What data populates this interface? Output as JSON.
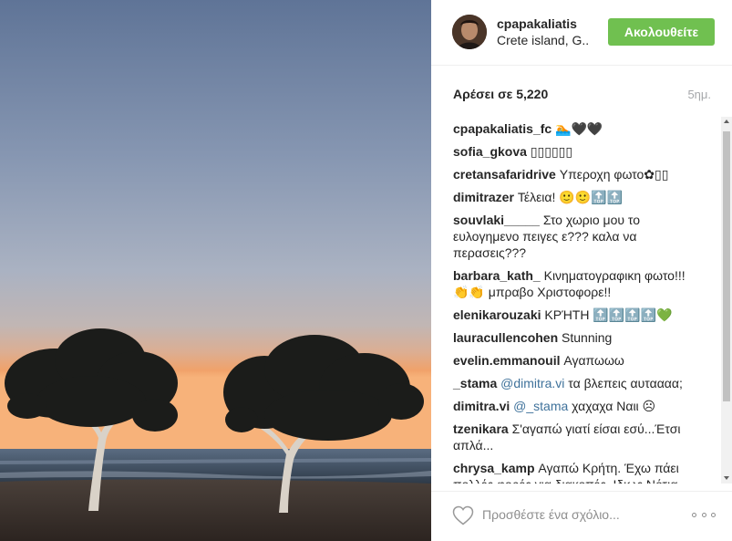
{
  "post": {
    "username": "cpapakaliatis",
    "location": "Crete island, G..",
    "follow_label": "Ακολουθείτε",
    "likes": "Αρέσει σε 5,220",
    "time": "5ημ."
  },
  "comments": [
    {
      "user": "cpapakaliatis_fc",
      "text": "🏊🖤🖤"
    },
    {
      "user": "sofia_gkova",
      "text": "▯▯▯▯▯▯"
    },
    {
      "user": "cretansafaridrive",
      "text": "Υπεροχη φωτο✿▯▯"
    },
    {
      "user": "dimitrazer",
      "text": "Τέλεια! 🙂🙂🔝🔝"
    },
    {
      "user": "souvlaki_____",
      "text": "Στο χωριο μου το ευλογημενο πειγες ε??? καλα να περασεις???"
    },
    {
      "user": "barbara_kath_",
      "text": "Κινηματογραφικη φωτο!!! 👏👏 μπραβο Χριστοφορε!!"
    },
    {
      "user": "elenikarouzaki",
      "text": "ΚΡΉΤΗ 🔝🔝🔝🔝💚"
    },
    {
      "user": "lauracullencohen",
      "text": "Stunning"
    },
    {
      "user": "evelin.emmanouil",
      "text": "Αγαπωωω"
    },
    {
      "user": "_stama",
      "mention": "@dimitra.vi",
      "text": "τα βλεπεις αυταααα;"
    },
    {
      "user": "dimitra.vi",
      "mention": "@_stama",
      "text": "χαχαχα Ναιι ☹"
    },
    {
      "user": "tzenikara",
      "text": "Σ'αγαπώ γιατί είσαι εσύ...Έτσι απλά..."
    },
    {
      "user": "chrysa_kamp",
      "text": "Αγαπώ Κρήτη. Έχω πάει πολλές φορές για διακοπές. Ιδιως Νότια."
    }
  ],
  "footer": {
    "comment_placeholder": "Προσθέστε ένα σχόλιο...",
    "like_icon": "heart-outline-icon",
    "more_icon": "more-options-icon"
  },
  "colors": {
    "follow_green": "#70c050",
    "mention_blue": "#3f729b",
    "muted_gray": "#a5a7aa"
  }
}
